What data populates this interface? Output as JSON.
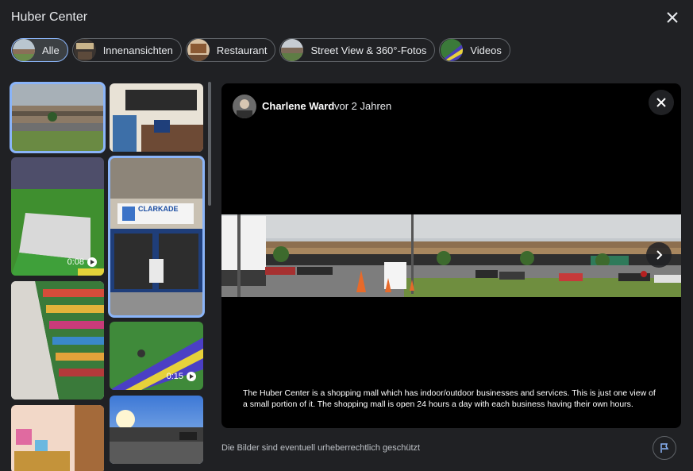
{
  "header": {
    "title": "Huber Center"
  },
  "chips": [
    {
      "label": "Alle",
      "active": true
    },
    {
      "label": "Innenansichten",
      "active": false
    },
    {
      "label": "Restaurant",
      "active": false
    },
    {
      "label": "Street View & 360°-Fotos",
      "active": false
    },
    {
      "label": "Videos",
      "active": false
    }
  ],
  "thumbs": {
    "video1_duration": "0:08",
    "video2_duration": "0:15",
    "store_sign": "CLARKADE"
  },
  "viewer": {
    "author": "Charlene Ward",
    "separator": "·",
    "time": "vor 2 Jahren",
    "caption": "The Huber Center is a shopping mall which has indoor/outdoor businesses and services. This is just one view of a small portion of it. The shopping mall is open 24 hours a day with each business having their own hours."
  },
  "footer": {
    "copyright": "Die Bilder sind eventuell urheberrechtlich geschützt"
  },
  "colors": {
    "accent": "#8ab4f8",
    "background": "#202124"
  }
}
